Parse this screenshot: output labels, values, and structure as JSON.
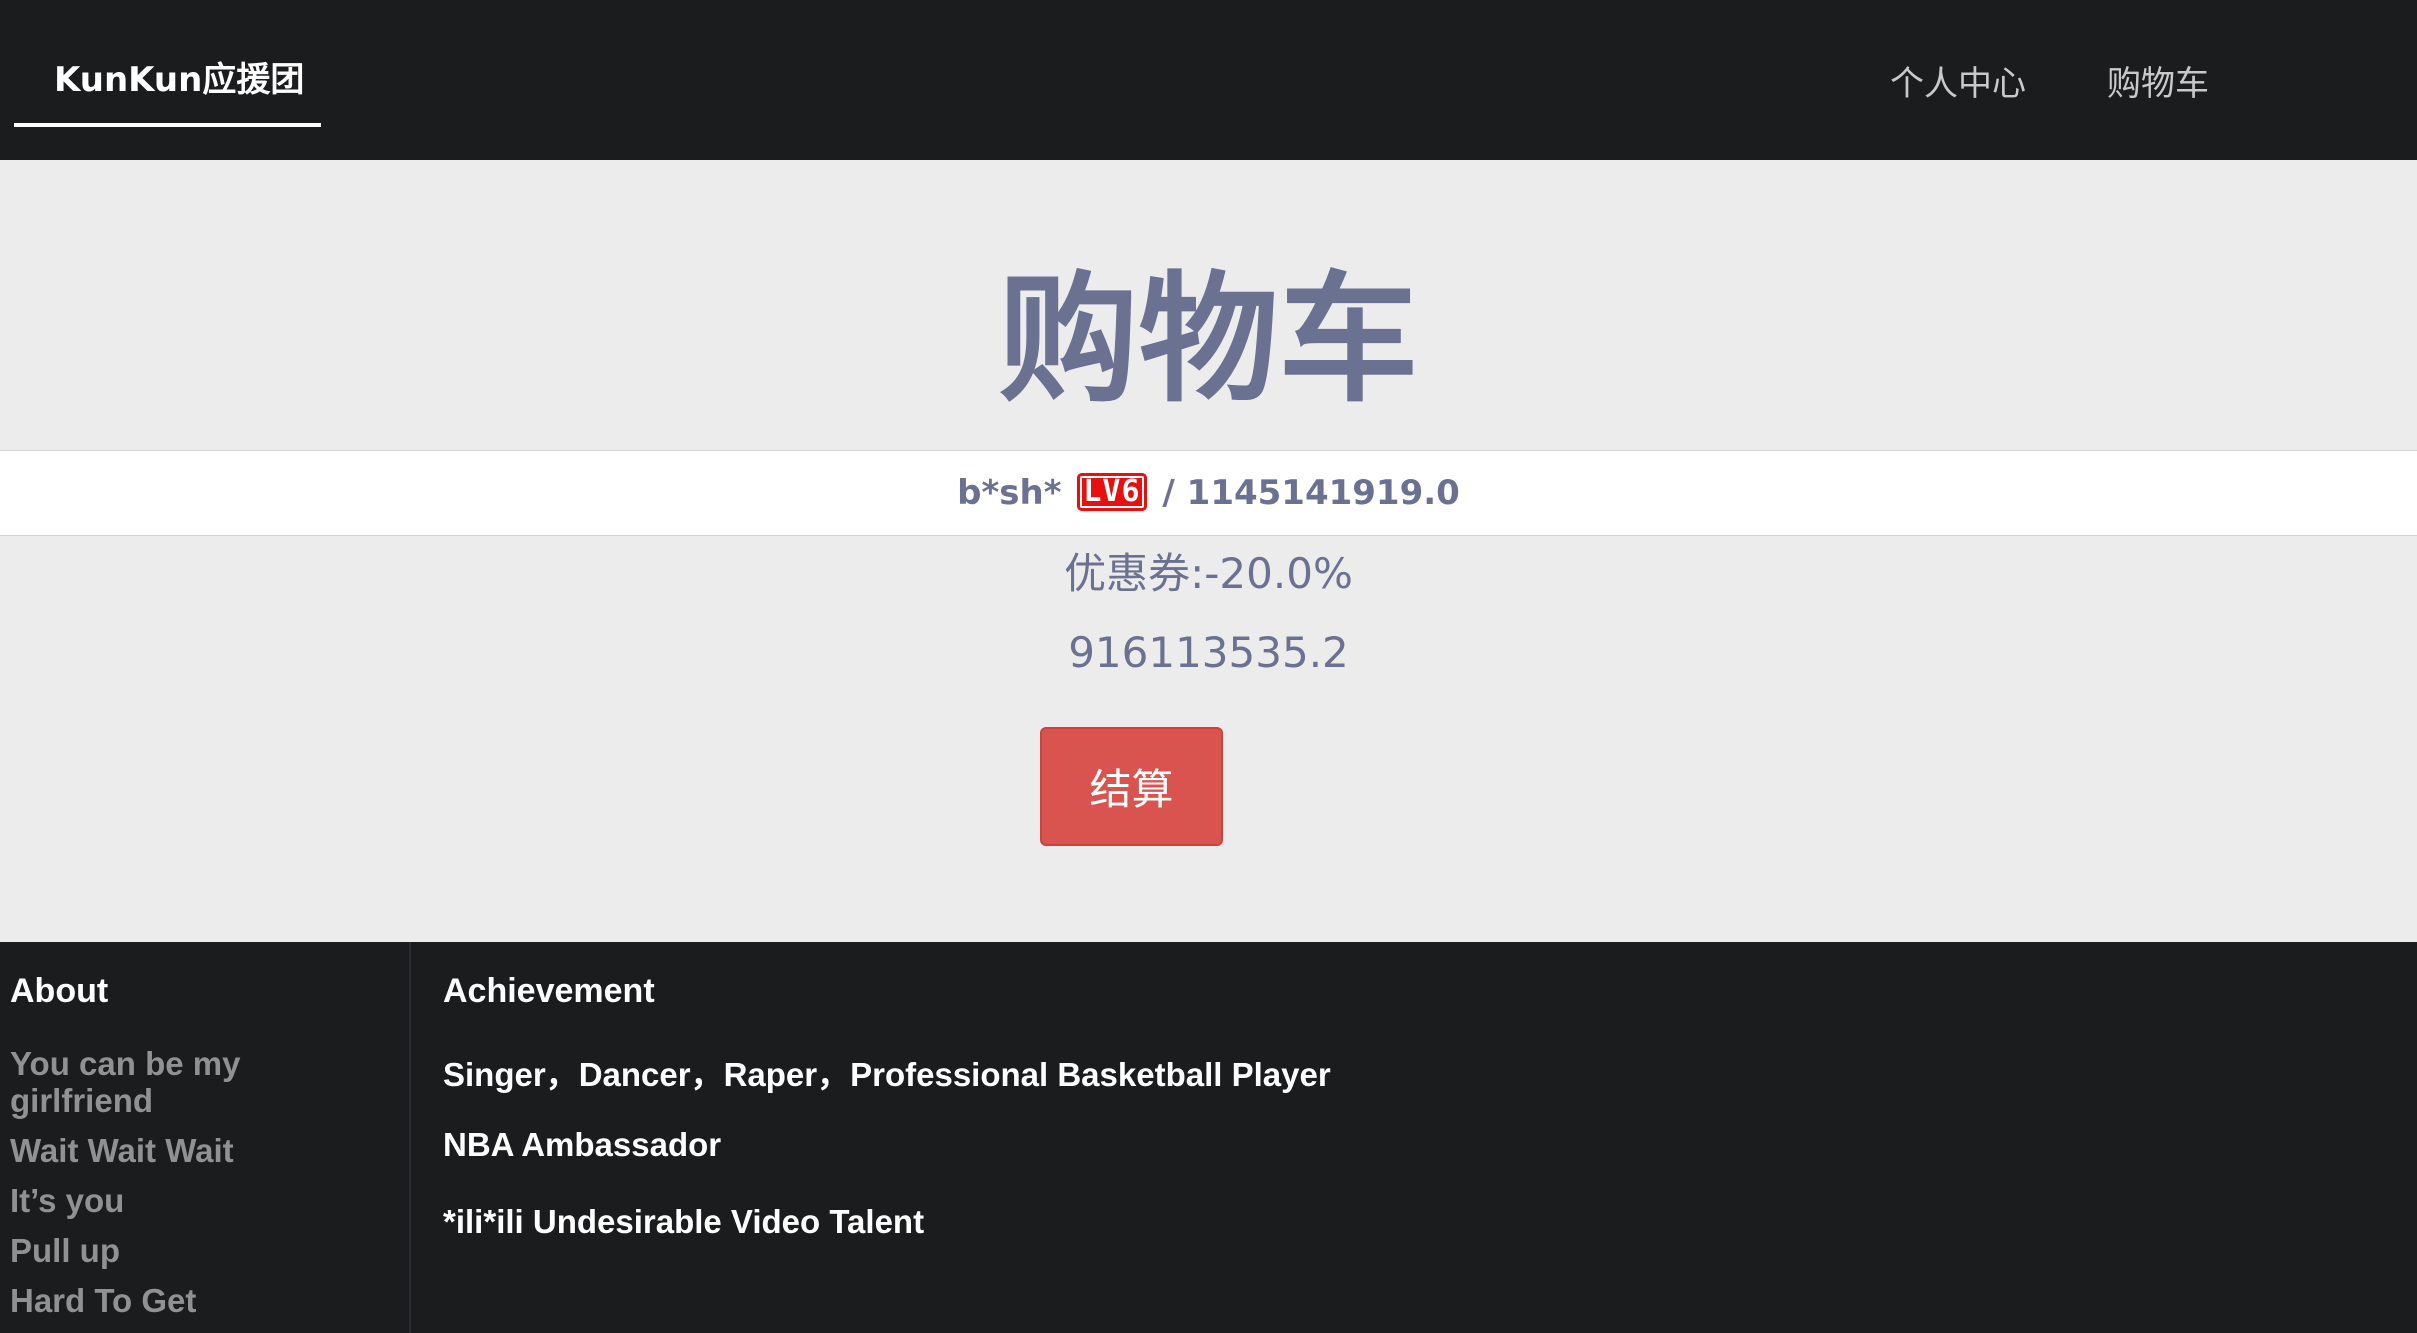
{
  "navbar": {
    "brand": "KunKun应援团",
    "links": [
      "个人中心",
      "购物车"
    ]
  },
  "page": {
    "title": "购物车"
  },
  "user": {
    "name": "b*sh*",
    "level": "LV6",
    "separator": "/",
    "balance": "1145141919.0"
  },
  "cart": {
    "coupon": "优惠券:-20.0%",
    "total": "916113535.2",
    "checkout_label": "结算"
  },
  "footer": {
    "about": {
      "heading": "About",
      "items": [
        "You can be my girlfriend",
        "Wait Wait Wait",
        "It’s you",
        "Pull up",
        "Hard To Get"
      ]
    },
    "achievement": {
      "heading": "Achievement",
      "items": [
        "Singer，Dancer，Raper，Professional Basketball Player",
        "NBA Ambassador",
        "*ili*ili Undesirable Video Talent"
      ]
    }
  },
  "colors": {
    "navbar_bg": "#1b1c1e",
    "page_bg": "#ececec",
    "text_accent": "#6b7190",
    "checkout_button": "#d9534f",
    "level_badge": "#e80f0f"
  }
}
